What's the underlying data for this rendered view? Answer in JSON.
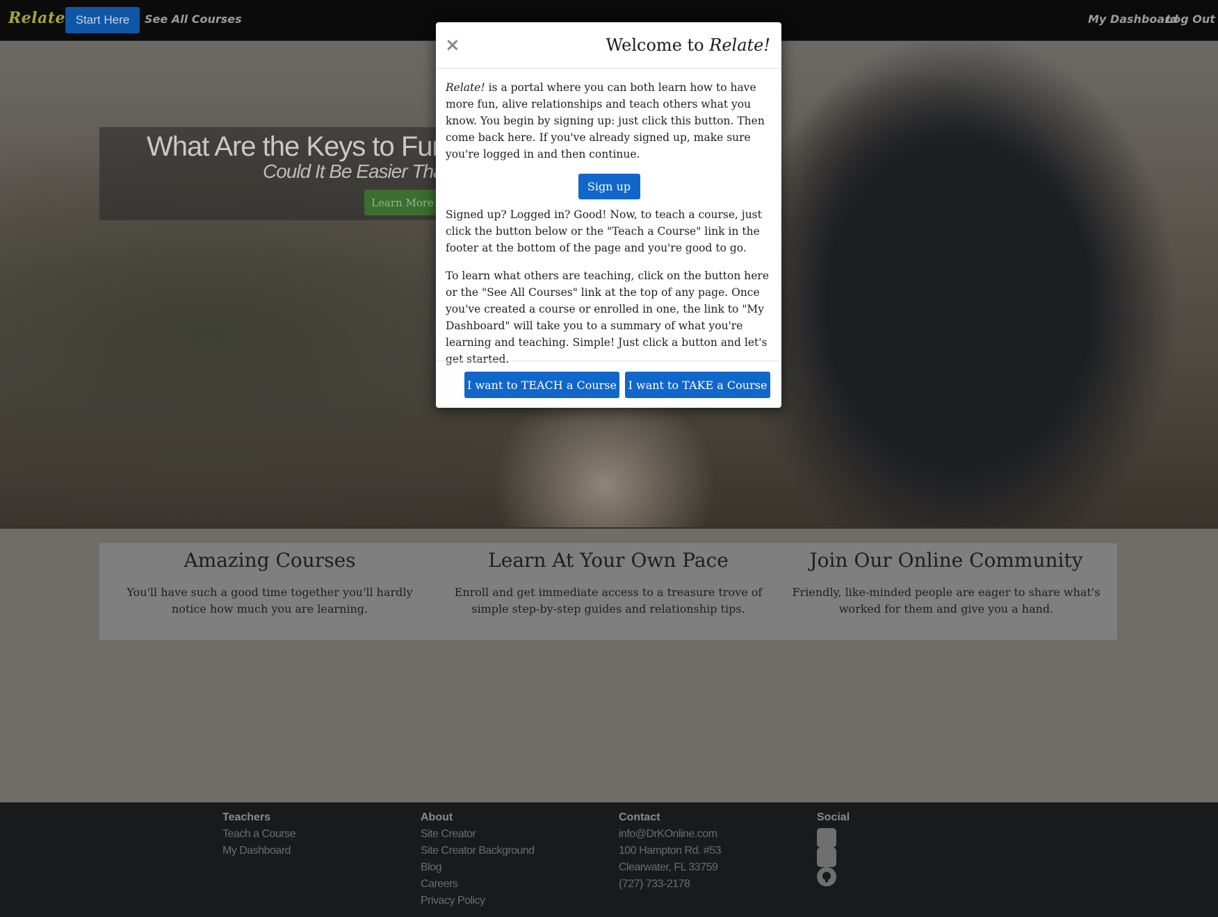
{
  "navbar": {
    "brand": "Relate!",
    "start_here": "Start Here",
    "see_all_courses": "See All Courses",
    "my_dashboard": "My Dashboard",
    "log_out": "Log Out"
  },
  "hero": {
    "title": "What Are the Keys to Fun",
    "subtitle": "Could It Be Easier Tha",
    "learn_more": "Learn More"
  },
  "features": [
    {
      "title": "Amazing Courses",
      "text": "You'll have such a good time together you'll hardly notice how much you are learning."
    },
    {
      "title": "Learn At Your Own Pace",
      "text": "Enroll and get immediate access to a treasure trove of simple step-by-step guides and relationship tips."
    },
    {
      "title": "Join Our Online Community",
      "text": "Friendly, like-minded people are eager to share what's worked for them and give you a hand."
    }
  ],
  "footer": {
    "teachers": {
      "heading": "Teachers",
      "links": [
        "Teach a Course",
        "My Dashboard"
      ]
    },
    "about": {
      "heading": "About",
      "links": [
        "Site Creator",
        "Site Creator Background",
        "Blog",
        "Careers",
        "Privacy Policy"
      ]
    },
    "contact": {
      "heading": "Contact",
      "lines": [
        "info@DrKOnline.com",
        "100 Hampton Rd. #53",
        "Clearwater, FL 33759",
        "(727) 733-2178"
      ]
    },
    "social": {
      "heading": "Social",
      "icons": [
        "facebook-icon",
        "linkedin-icon",
        "github-icon"
      ]
    }
  },
  "modal": {
    "close": "×",
    "title_prefix": "Welcome to ",
    "title_brand": "Relate!",
    "p1_brand": "Relate!",
    "p1_text": " is a portal where you can both learn how to have more fun, alive relationships and teach others what you know. You begin by signing up: just click this button. Then come back here. If you've already signed up, make sure you're logged in and then continue.",
    "sign_up": "Sign up",
    "p2": "Signed up? Logged in? Good! Now, to teach a course, just click the button below or the \"Teach a Course\" link in the footer at the bottom of the page and you're good to go.",
    "p3": "To learn what others are teaching, click on the button here or the \"See All Courses\" link at the top of any page. Once you've created a course or enrolled in one, the link to \"My Dashboard\" will take you to a summary of what you're learning and teaching. Simple! Just click a button and let's get started.",
    "teach_button": "I want to TEACH a Course",
    "take_button": "I want to TAKE a Course"
  },
  "colors": {
    "primary_button": "#1166c9",
    "navbar_bg": "#0b0b0b",
    "brand": "#a9a33a",
    "footer_bg": "#181a1b"
  }
}
